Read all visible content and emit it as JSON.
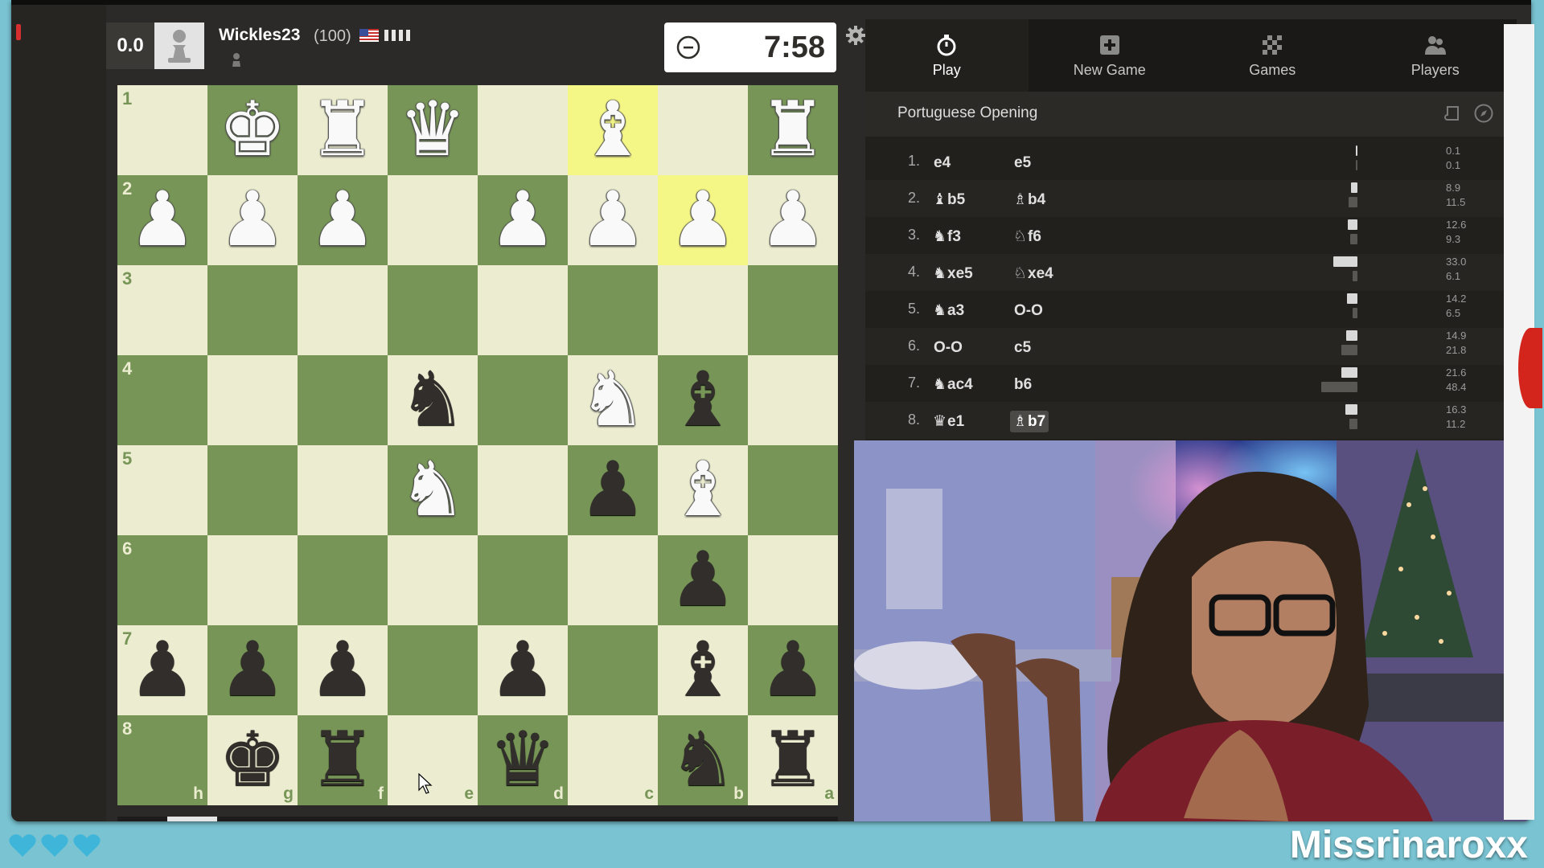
{
  "player": {
    "eval": "0.0",
    "name": "Wickles23",
    "rating": "(100)",
    "flag_icon": "us-flag-icon",
    "signal_icon": "connection-bars-icon"
  },
  "clock": {
    "time": "7:58"
  },
  "board": {
    "orientation": "black-bottom",
    "ranks": [
      "1",
      "2",
      "3",
      "4",
      "5",
      "6",
      "7",
      "8"
    ],
    "files": [
      "h",
      "g",
      "f",
      "e",
      "d",
      "c",
      "b",
      "a"
    ],
    "highlight_squares": [
      "b2",
      "c1"
    ],
    "pieces": [
      "..WKWRWQ..WB..WR",
      "WPWPWP..WPWPWPWP",
      "................",
      "......BN..WNBB..",
      "......WN..BPWB..",
      "............BP..",
      "BPBPBP..BP..BBBP",
      "..BKBR..BQ..BNBR"
    ]
  },
  "tabs": [
    {
      "label": "Play",
      "icon": "stopwatch-icon",
      "active": true
    },
    {
      "label": "New Game",
      "icon": "plus-square-icon",
      "active": false
    },
    {
      "label": "Games",
      "icon": "checkerboard-icon",
      "active": false
    },
    {
      "label": "Players",
      "icon": "people-icon",
      "active": false
    }
  ],
  "opening": {
    "name": "Portuguese Opening"
  },
  "moves": [
    {
      "num": "1.",
      "white": "e4",
      "white_fig": "",
      "black": "e5",
      "black_fig": "",
      "wt": "0.1",
      "bt": "0.1"
    },
    {
      "num": "2.",
      "white": "b5",
      "white_fig": "♝",
      "black": "b4",
      "black_fig": "♗",
      "wt": "8.9",
      "bt": "11.5"
    },
    {
      "num": "3.",
      "white": "f3",
      "white_fig": "♞",
      "black": "f6",
      "black_fig": "♘",
      "wt": "12.6",
      "bt": "9.3"
    },
    {
      "num": "4.",
      "white": "xe5",
      "white_fig": "♞",
      "black": "xe4",
      "black_fig": "♘",
      "wt": "33.0",
      "bt": "6.1"
    },
    {
      "num": "5.",
      "white": "a3",
      "white_fig": "♞",
      "black": "O-O",
      "black_fig": "",
      "wt": "14.2",
      "bt": "6.5"
    },
    {
      "num": "6.",
      "white": "O-O",
      "white_fig": "",
      "black": "c5",
      "black_fig": "",
      "wt": "14.9",
      "bt": "21.8"
    },
    {
      "num": "7.",
      "white": "ac4",
      "white_fig": "♞",
      "black": "b6",
      "black_fig": "",
      "wt": "21.6",
      "bt": "48.4"
    },
    {
      "num": "8.",
      "white": "e1",
      "white_fig": "♛",
      "black": "b7",
      "black_fig": "♗",
      "wt": "16.3",
      "bt": "11.2"
    }
  ],
  "current_move": {
    "row": 7,
    "side": "black"
  },
  "stream": {
    "channel": "Missrinaroxx",
    "hearts": 3
  },
  "colors": {
    "board_light": "#ebecd0",
    "board_dark": "#779556",
    "highlight": "#f6f669",
    "overlay": "#79c3d2"
  }
}
